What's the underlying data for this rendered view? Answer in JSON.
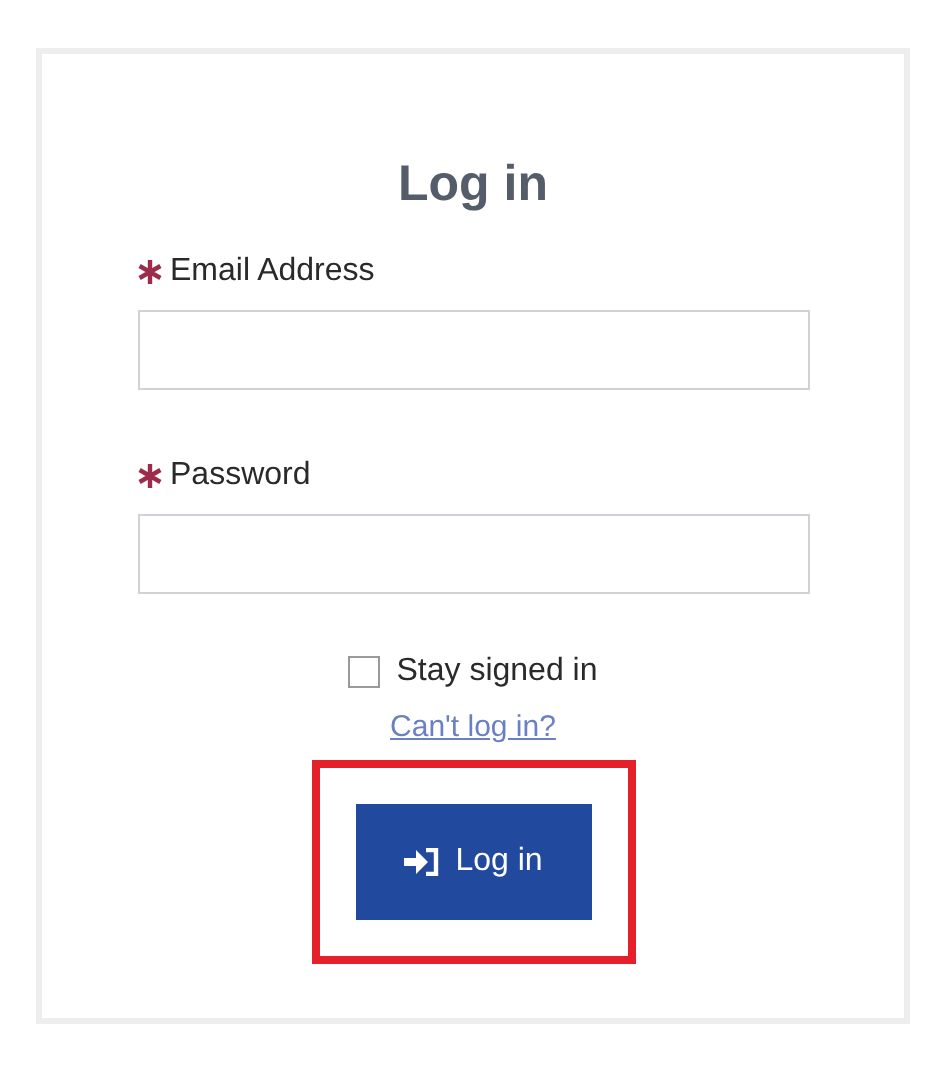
{
  "title": "Log in",
  "fields": [
    {
      "label": "Email Address",
      "required": true
    },
    {
      "label": "Password",
      "required": true
    }
  ],
  "stay_signed_in": {
    "label": "Stay signed in",
    "checked": false
  },
  "help_link": "Can't log in?",
  "submit": {
    "label": "Log in",
    "highlighted": true
  }
}
